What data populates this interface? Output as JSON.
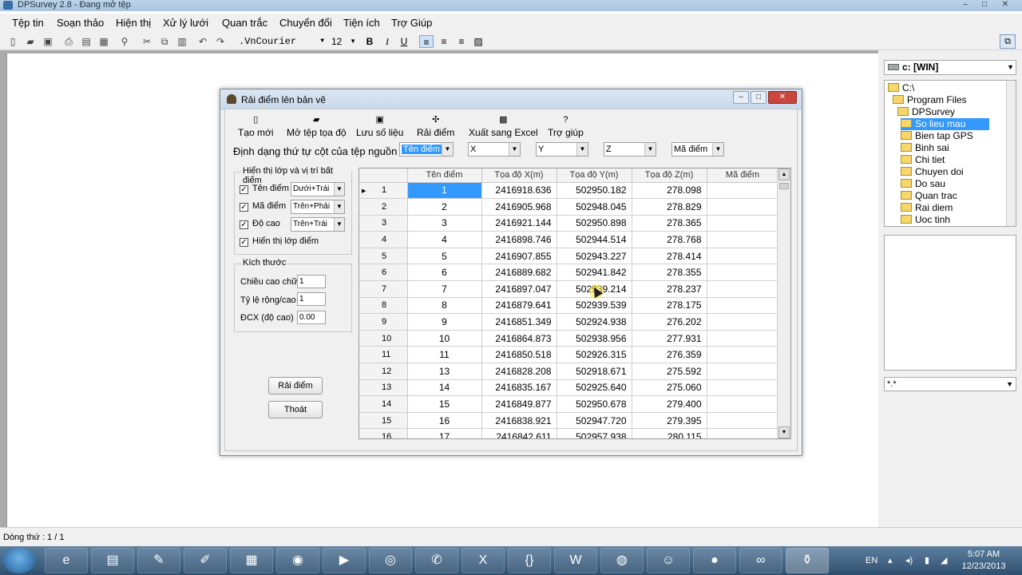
{
  "app": {
    "title": "DPSurvey 2.8 - Đang mở tệp"
  },
  "menu": [
    "Tệp tin",
    "Soạn thảo",
    "Hiện thị",
    "Xử lý lưới",
    "Quan trắc",
    "Chuyển đổi",
    "Tiện ích",
    "Trợ Giúp"
  ],
  "toolbar": {
    "font": "VnCourier",
    "font_prefix": ".",
    "size": "12",
    "bold": "B",
    "italic": "I",
    "underline": "U",
    "icons": [
      "new-file-icon",
      "open-folder-icon",
      "save-icon",
      "print-icon",
      "print-preview-icon",
      "copy-doc-icon",
      "find-icon",
      "cut-icon",
      "copy-icon",
      "paste-icon",
      "undo-icon",
      "redo-icon",
      "align-left-icon",
      "align-center-icon",
      "align-right-icon",
      "image-icon"
    ]
  },
  "right_panel": {
    "drive": "c: [WIN]",
    "tree": [
      "C:\\",
      "Program Files",
      "DPSurvey",
      "So lieu mau",
      "Bien tap GPS",
      "Binh sai",
      "Chi tiet",
      "Chuyen doi",
      "Do sau",
      "Quan trac",
      "Rai diem",
      "Uoc tinh"
    ],
    "selected": "So lieu mau",
    "filter": "*.*"
  },
  "status": "Dòng thứ : 1 / 1",
  "dialog": {
    "title": "Rải điểm lên bản vẽ",
    "toolbar": [
      "Tạo mới",
      "Mở tệp tọa độ",
      "Lưu số liệu",
      "Rải điểm",
      "Xuất sang Excel",
      "Trợ giúp"
    ],
    "format_label": "Định dạng thứ tự cột của tệp nguồn",
    "format_columns": [
      "Tên điểm",
      "X",
      "Y",
      "Z",
      "Mã điểm"
    ],
    "display_group": {
      "legend": "Hiển thị lớp và vị trí bất điểm",
      "items": [
        {
          "label": "Tên điểm",
          "checked": true,
          "position": "Dưới+Trái"
        },
        {
          "label": "Mã điểm",
          "checked": true,
          "position": "Trên+Phải"
        },
        {
          "label": "Độ cao",
          "checked": true,
          "position": "Trên+Trái"
        }
      ],
      "show_layer": "Hiển thị lớp điểm"
    },
    "size_group": {
      "legend": "Kích thước",
      "fields": [
        {
          "label": "Chiều cao chữ",
          "value": "1"
        },
        {
          "label": "Tỷ lệ rộng/cao",
          "value": "1"
        },
        {
          "label": "ĐCX (độ cao)",
          "value": "0.00"
        }
      ]
    },
    "buttons": {
      "plot": "Rải điểm",
      "exit": "Thoát"
    },
    "grid": {
      "headers": [
        "Tên điểm",
        "Tọa độ X(m)",
        "Tọa độ Y(m)",
        "Tọa độ Z(m)",
        "Mã điểm"
      ],
      "rows": [
        [
          "1",
          "1",
          "2416918.636",
          "502950.182",
          "278.098",
          ""
        ],
        [
          "2",
          "2",
          "2416905.968",
          "502948.045",
          "278.829",
          ""
        ],
        [
          "3",
          "3",
          "2416921.144",
          "502950.898",
          "278.365",
          ""
        ],
        [
          "4",
          "4",
          "2416898.746",
          "502944.514",
          "278.768",
          ""
        ],
        [
          "5",
          "5",
          "2416907.855",
          "502943.227",
          "278.414",
          ""
        ],
        [
          "6",
          "6",
          "2416889.682",
          "502941.842",
          "278.355",
          ""
        ],
        [
          "7",
          "7",
          "2416897.047",
          "502939.214",
          "278.237",
          ""
        ],
        [
          "8",
          "8",
          "2416879.641",
          "502939.539",
          "278.175",
          ""
        ],
        [
          "9",
          "9",
          "2416851.349",
          "502924.938",
          "276.202",
          ""
        ],
        [
          "10",
          "10",
          "2416864.873",
          "502938.956",
          "277.931",
          ""
        ],
        [
          "11",
          "11",
          "2416850.518",
          "502926.315",
          "276.359",
          ""
        ],
        [
          "12",
          "13",
          "2416828.208",
          "502918.671",
          "275.592",
          ""
        ],
        [
          "13",
          "14",
          "2416835.167",
          "502925.640",
          "275.060",
          ""
        ],
        [
          "14",
          "15",
          "2416849.877",
          "502950.678",
          "279.400",
          ""
        ],
        [
          "15",
          "16",
          "2416838.921",
          "502947.720",
          "279.395",
          ""
        ],
        [
          "16",
          "17",
          "2416842.611",
          "502957.938",
          "280.115",
          ""
        ]
      ]
    }
  },
  "taskbar": {
    "apps": [
      "start-button",
      "internet-explorer-icon",
      "file-explorer-icon",
      "notepad-icon",
      "paint-icon",
      "calculator-icon",
      "media-icon",
      "media-player-icon",
      "chrome-icon",
      "viber-icon",
      "excel-icon",
      "code-editor-icon",
      "word-icon",
      "globe-app-icon",
      "yahoo-messenger-icon",
      "orange-app-icon",
      "link-app-icon",
      "dpsurvey-icon"
    ],
    "lang": "EN",
    "time": "5:07 AM",
    "date": "12/23/2013"
  }
}
